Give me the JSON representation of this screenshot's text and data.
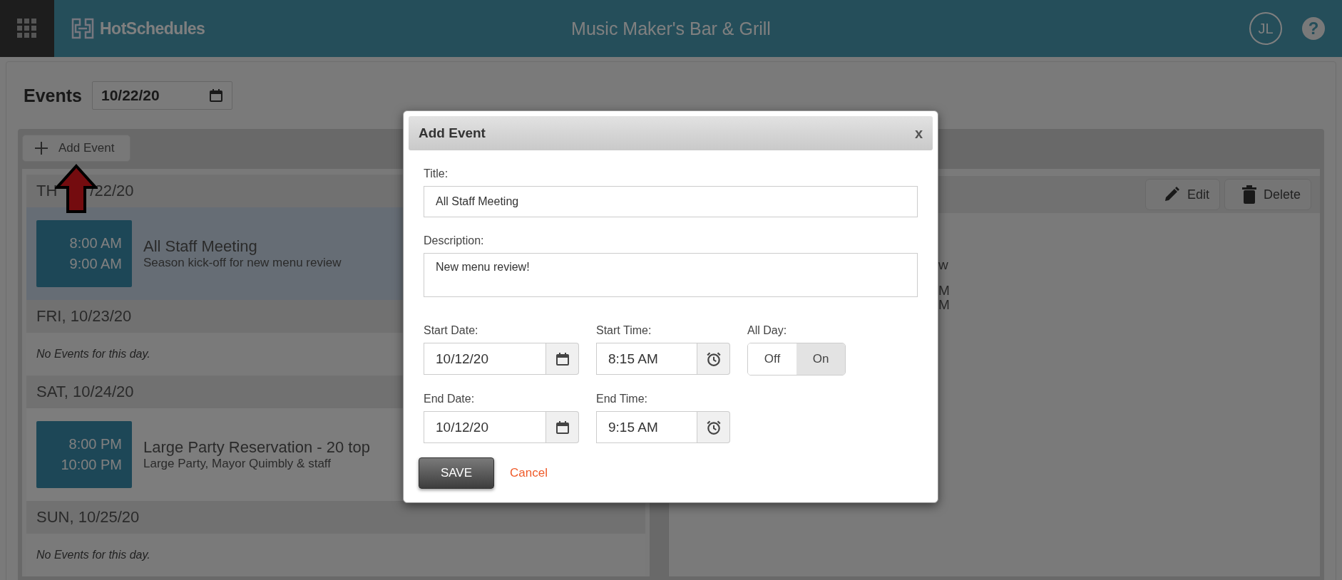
{
  "header": {
    "app_name": "HotSchedules",
    "venue": "Music Maker's Bar & Grill",
    "user_initials": "JL",
    "help": "?"
  },
  "events_page": {
    "title": "Events",
    "date": "10/22/20",
    "add_button": "Add Event",
    "days": [
      {
        "label": "TH",
        "label_end": "/22/20",
        "events": [
          {
            "start": "8:00 AM",
            "end": "9:00 AM",
            "title": "All Staff Meeting",
            "description": "Season kick-off for new menu review",
            "selected": true
          }
        ]
      },
      {
        "label": "FRI, 10/23/20",
        "empty_text": "No Events for this day."
      },
      {
        "label": "SAT, 10/24/20",
        "events": [
          {
            "start": "8:00 PM",
            "end": "10:00 PM",
            "title": "Large Party Reservation - 20 top",
            "description": "Large Party, Mayor Quimbly & staff",
            "selected": false
          }
        ]
      },
      {
        "label": "SUN, 10/25/20",
        "empty_text": "No Events for this day."
      }
    ],
    "detail": {
      "buttons": [
        {
          "kind": "edit",
          "label": "Edit"
        },
        {
          "kind": "delete",
          "label": "Delete"
        }
      ],
      "fragments": [
        "w",
        "M",
        "M"
      ]
    }
  },
  "dialog": {
    "title": "Add Event",
    "close": "x",
    "title_field": {
      "label": "Title:",
      "value": "All Staff Meeting"
    },
    "description_field": {
      "label": "Description:",
      "value": "New menu review!"
    },
    "rows": [
      [
        {
          "kind": "date",
          "label": "Start Date:",
          "value": "10/12/20"
        },
        {
          "kind": "time",
          "label": "Start Time:",
          "value": "8:15 AM"
        },
        {
          "kind": "toggle",
          "label": "All Day:",
          "options": [
            {
              "label": "Off",
              "selected": true
            },
            {
              "label": "On",
              "selected": false
            }
          ]
        }
      ],
      [
        {
          "kind": "date",
          "label": "End Date:",
          "value": "10/12/20"
        },
        {
          "kind": "time",
          "label": "End Time:",
          "value": "9:15 AM"
        }
      ]
    ],
    "save": "SAVE",
    "cancel": "Cancel"
  }
}
